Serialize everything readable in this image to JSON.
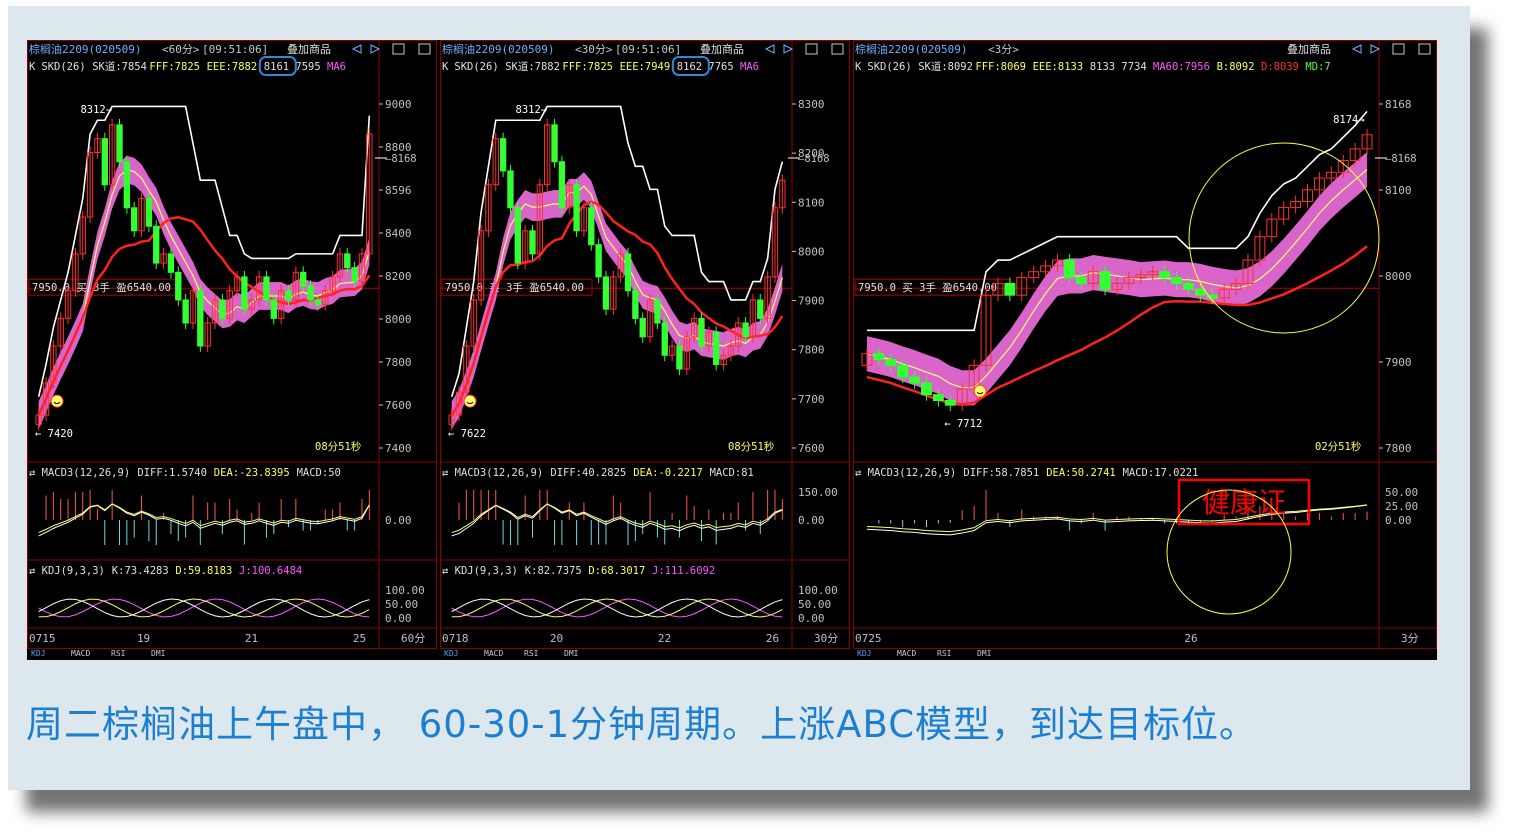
{
  "caption": "周二棕榈油上午盘中， 60-30-1分钟周期。上涨ABC模型，到达目标位。",
  "stamp": "健康证",
  "colors": {
    "up": "#ff3030",
    "down": "#33ff33",
    "white": "#ffffff",
    "yellow": "#ffff66",
    "magenta": "#ff55ff",
    "label": "#ff5555",
    "axis": "#c0c0c0"
  },
  "toolbar_icons": [
    "arrow-left-icon",
    "arrow-right-icon",
    "grid-icon",
    "window-icon"
  ],
  "panels": [
    {
      "id": "p60",
      "symbol": "棕榈油2209(020509)",
      "period": "<60分>",
      "time": "[09:51:06]",
      "overlay": "叠加商品",
      "indicator": {
        "k": "K",
        "skd": "SKD(26)",
        "sk": "SK道:7854",
        "fff": "FFF:7825",
        "eee": "EEE:7882",
        "v1": "8161",
        "v2": "7595",
        "ma": "MA6"
      },
      "price_ticks": [
        "9000",
        "8800",
        "8596",
        "8400",
        "8200",
        "8000",
        "7800",
        "7600",
        "7400"
      ],
      "marker_high": "8312",
      "marker_low": "7420",
      "right_mark": "8168",
      "trade": "7950.0 买 3手 盈6540.00",
      "countdown": "08分51秒",
      "macd": {
        "title": "MACD3(12,26,9)",
        "diff": "DIFF:1.5740",
        "dea": "DEA:-23.8395",
        "macd": "MACD:50",
        "ticks": [
          "0.00"
        ]
      },
      "kdj": {
        "title": "KDJ(9,3,3)",
        "k": "K:73.4283",
        "d": "D:59.8183",
        "j": "J:100.6484",
        "ticks": [
          "100.00",
          "50.00",
          "0.00"
        ]
      },
      "dates": [
        "0715",
        "19",
        "21",
        "25"
      ],
      "period_label": "60分",
      "tabs": [
        "KDJ",
        "MACD",
        "RSI",
        "DMI"
      ],
      "chart_data": {
        "type": "candlestick",
        "closes": [
          7550,
          7620,
          7700,
          7760,
          7820,
          7900,
          7980,
          8120,
          8150,
          8050,
          8180,
          8100,
          8000,
          7950,
          8020,
          7960,
          7880,
          7900,
          7860,
          7800,
          7750,
          7820,
          7700,
          7750,
          7800,
          7760,
          7820,
          7850,
          7780,
          7800,
          7850,
          7800,
          7760,
          7820,
          7800,
          7860,
          7830,
          7800,
          7790,
          7820,
          7850,
          7900,
          7870,
          7840,
          7900,
          8160
        ]
      }
    },
    {
      "id": "p30",
      "symbol": "棕榈油2209(020509)",
      "period": "<30分>",
      "time": "[09:51:06]",
      "overlay": "叠加商品",
      "indicator": {
        "k": "K",
        "skd": "SKD(26)",
        "sk": "SK道:7882",
        "fff": "FFF:7825",
        "eee": "EEE:7949",
        "v1": "8162",
        "v2": "7765",
        "ma": "MA6"
      },
      "price_ticks": [
        "8300",
        "8200",
        "8100",
        "8000",
        "7900",
        "7800",
        "7700",
        "7600"
      ],
      "marker_high": "8312",
      "marker_low": "7622",
      "right_mark": "8168",
      "trade": "7950.0 买 3手 盈6540.00",
      "countdown": "08分51秒",
      "macd": {
        "title": "MACD3(12,26,9)",
        "diff": "DIFF:40.2825",
        "dea": "DEA:-0.2217",
        "macd": "MACD:81",
        "ticks": [
          "150.00",
          "0.00"
        ]
      },
      "kdj": {
        "title": "KDJ(9,3,3)",
        "k": "K:82.7375",
        "d": "D:68.3017",
        "j": "J:111.6092",
        "ticks": [
          "100.00",
          "50.00",
          "0.00"
        ]
      },
      "dates": [
        "0718",
        "20",
        "22",
        "26"
      ],
      "period_label": "30分",
      "tabs": [
        "KDJ",
        "MACD",
        "RSI",
        "DMI"
      ],
      "chart_data": {
        "type": "candlestick",
        "closes": [
          7650,
          7700,
          7800,
          7900,
          8050,
          8150,
          8250,
          8180,
          8100,
          7980,
          8050,
          8000,
          8150,
          8280,
          8200,
          8100,
          8150,
          8050,
          8100,
          8020,
          7950,
          7880,
          7950,
          8000,
          7920,
          7860,
          7820,
          7900,
          7850,
          7780,
          7800,
          7750,
          7820,
          7860,
          7800,
          7830,
          7760,
          7780,
          7800,
          7850,
          7820,
          7900,
          7860,
          7950,
          8100,
          8160
        ]
      }
    },
    {
      "id": "p3",
      "symbol": "棕榈油2209(020509)",
      "period": "<3分>",
      "time": "",
      "overlay": "叠加商品",
      "indicator": {
        "k": "K",
        "skd": "SKD(26)",
        "sk": "SK道:8092",
        "fff": "FFF:8069",
        "eee": "EEE:8133",
        "v1": "8133",
        "v2": "7734",
        "ma": "MA60:7956",
        "b": "B:8092",
        "d": "D:8039",
        "md": "MD:7"
      },
      "price_ticks": [
        "8168",
        "8100",
        "8000",
        "7900",
        "7800"
      ],
      "marker_high": "8174",
      "marker_low": "7712",
      "right_mark": "8168",
      "trade": "7950.0 买 3手 盈6540.00",
      "countdown": "02分51秒",
      "macd": {
        "title": "MACD3(12,26,9)",
        "diff": "DIFF:58.7851",
        "dea": "DEA:50.2741",
        "macd": "MACD:17.0221",
        "ticks": [
          "50.00",
          "25.00",
          "0.00"
        ]
      },
      "dates": [
        "0725",
        "26"
      ],
      "period_label": "3分",
      "tabs": [
        "KDJ",
        "MACD",
        "RSI",
        "DMI"
      ],
      "chart_data": {
        "type": "candlestick",
        "closes": [
          7800,
          7790,
          7780,
          7760,
          7750,
          7730,
          7720,
          7712,
          7740,
          7780,
          7900,
          7920,
          7900,
          7930,
          7940,
          7950,
          7960,
          7930,
          7920,
          7940,
          7910,
          7920,
          7930,
          7935,
          7940,
          7930,
          7920,
          7910,
          7900,
          7895,
          7910,
          7920,
          7960,
          8000,
          8030,
          8050,
          8060,
          8080,
          8100,
          8110,
          8130,
          8150,
          8174
        ]
      }
    }
  ]
}
